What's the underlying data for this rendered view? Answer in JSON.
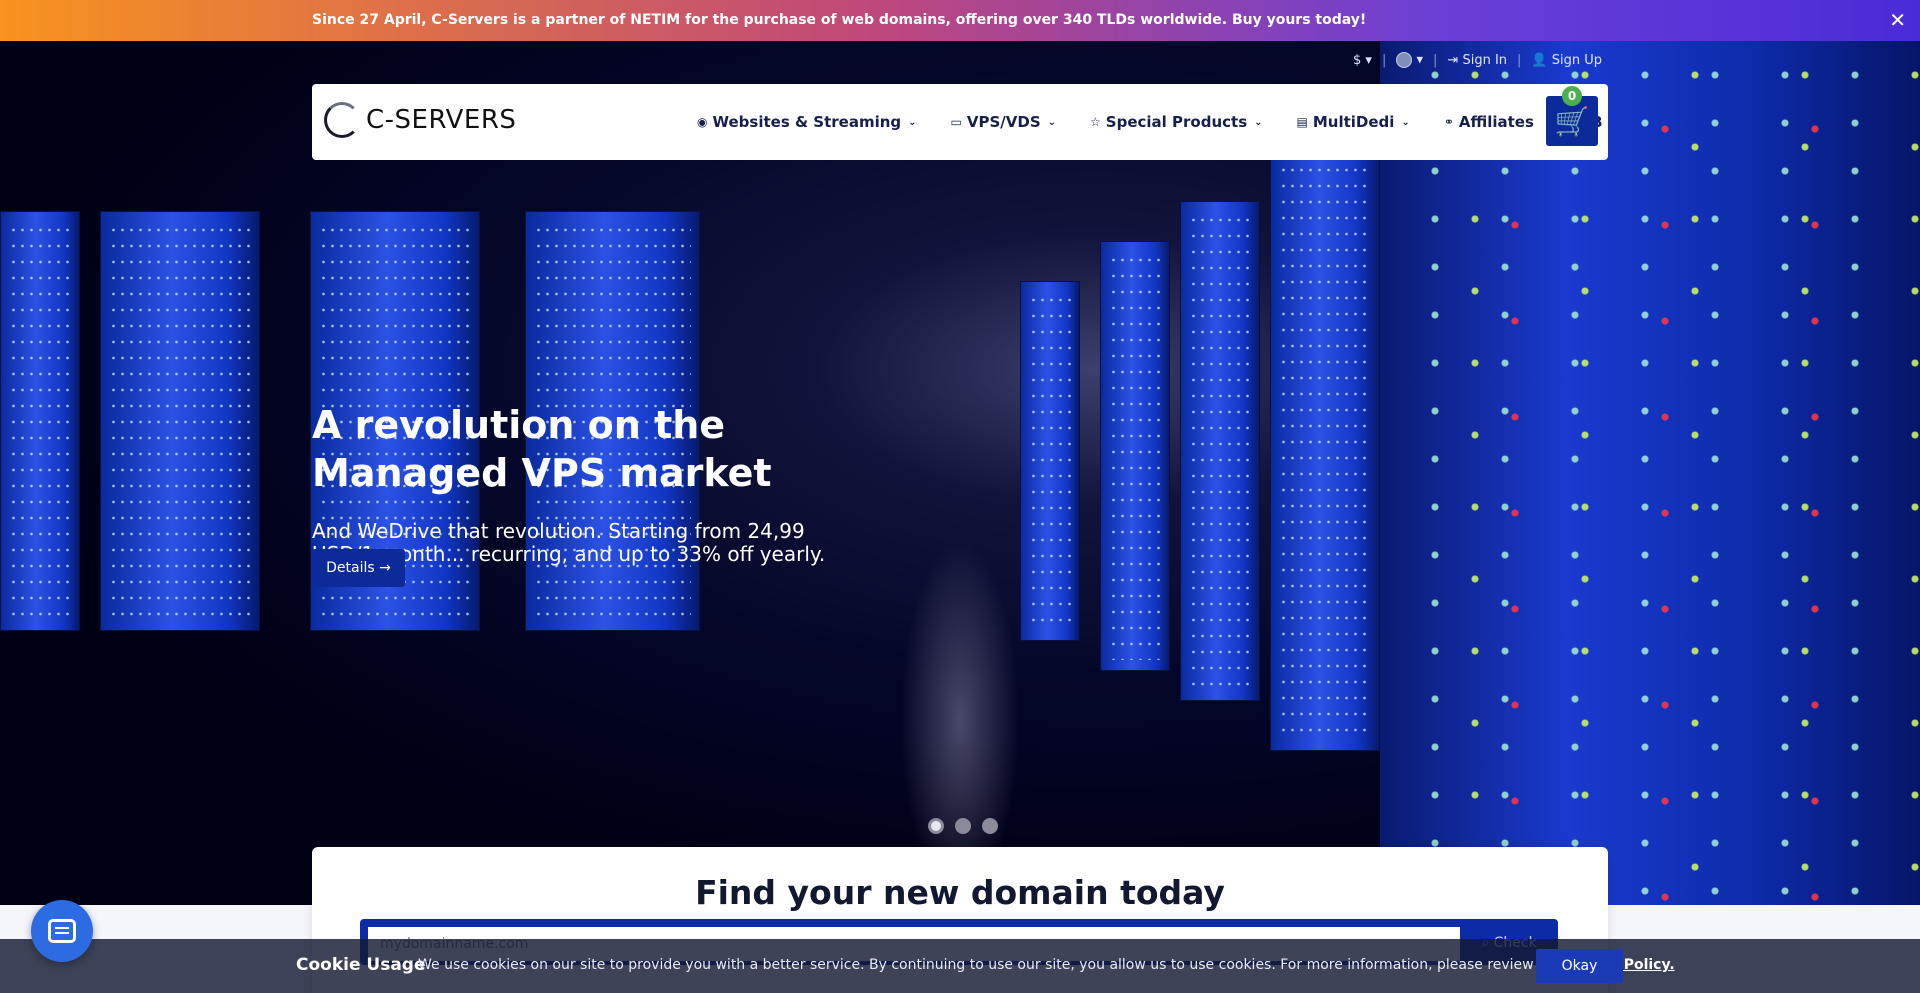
{
  "announcement": {
    "text": "Since 27 April, C-Servers is a partner of NETIM for the purchase of web domains, offering over 340 TLDs worldwide. Buy yours today!",
    "close_icon": "close-icon"
  },
  "utility": {
    "currency": "$ ▾",
    "language_caret": "▾",
    "sign_in": "Sign In",
    "sign_up": "Sign Up"
  },
  "brand": {
    "logo_text": "C-SERVERS"
  },
  "nav": {
    "items": [
      {
        "label": "Websites & Streaming",
        "icon": "globe-icon",
        "has_dropdown": true
      },
      {
        "label": "VPS/VDS",
        "icon": "laptop-icon",
        "has_dropdown": true
      },
      {
        "label": "Special Products",
        "icon": "star-icon",
        "has_dropdown": true
      },
      {
        "label": "MultiDedi",
        "icon": "server-icon",
        "has_dropdown": true
      },
      {
        "label": "Affiliates",
        "icon": "handshake-icon",
        "has_dropdown": false
      },
      {
        "label": "KB",
        "icon": "book-icon",
        "has_dropdown": false
      }
    ],
    "cart_count": "0"
  },
  "hero": {
    "title": "A revolution on the Managed VPS market",
    "subtitle": "And WeDrive that revolution. Starting from 24,99 USD/1 month... recurring, and up to 33% off yearly.",
    "details_label": "Details →",
    "slides": 3,
    "active_slide": 1
  },
  "domain_search": {
    "title": "Find your new domain today",
    "placeholder": "mydomainname.com",
    "check_label": "Check"
  },
  "cookie": {
    "title": "Cookie Usage",
    "text": "We use cookies on our site to provide you with a better service. By continuing to use our site, you allow us to use cookies. For more information, please review our",
    "link": "Cookie Policy.",
    "okay_label": "Okay"
  },
  "colors": {
    "primary": "#0d2a9a",
    "announce_start": "#f7931e",
    "announce_end": "#4b2bd8",
    "badge": "#4caf50"
  }
}
